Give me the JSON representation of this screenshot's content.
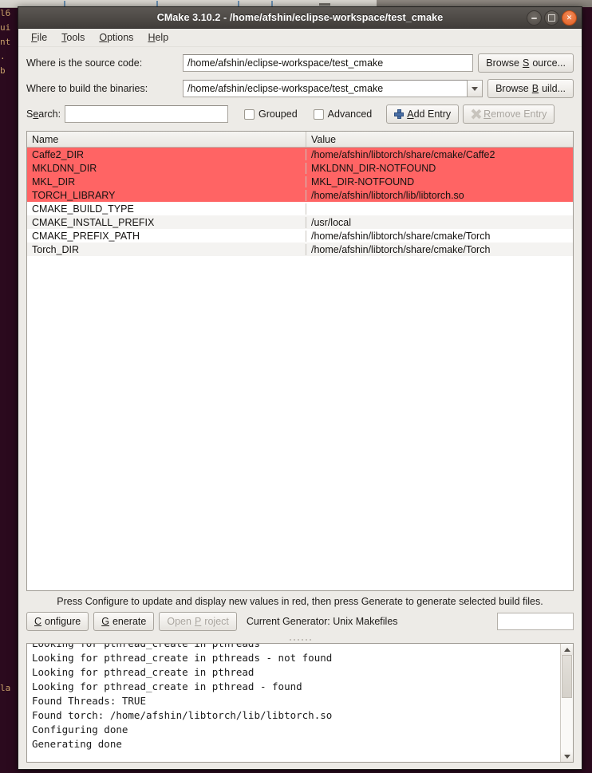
{
  "window": {
    "title": "CMake 3.10.2 - /home/afshin/eclipse-workspace/test_cmake",
    "buttons": {
      "minimize": "minimize",
      "maximize": "maximize",
      "close": "close"
    }
  },
  "menubar": [
    {
      "label": "File",
      "accel": "F"
    },
    {
      "label": "Tools",
      "accel": "T"
    },
    {
      "label": "Options",
      "accel": "O"
    },
    {
      "label": "Help",
      "accel": "H"
    }
  ],
  "form": {
    "source_label": "Where is the source code:",
    "source_value": "/home/afshin/eclipse-workspace/test_cmake",
    "browse_source_label": "Browse Source...",
    "browse_source_accel": "S",
    "build_label": "Where to build the binaries:",
    "build_value": "/home/afshin/eclipse-workspace/test_cmake",
    "browse_build_label": "Browse Build...",
    "browse_build_accel": "B"
  },
  "search": {
    "label": "Search:",
    "value": "",
    "placeholder": "",
    "grouped_label": "Grouped",
    "grouped_checked": false,
    "advanced_label": "Advanced",
    "advanced_checked": false,
    "add_entry_label": "Add Entry",
    "add_entry_accel": "A",
    "remove_entry_label": "Remove Entry",
    "remove_entry_accel": "R",
    "remove_entry_enabled": false
  },
  "table": {
    "columns": [
      "Name",
      "Value"
    ],
    "rows": [
      {
        "name": "Caffe2_DIR",
        "value": "/home/afshin/libtorch/share/cmake/Caffe2",
        "state": "new"
      },
      {
        "name": "MKLDNN_DIR",
        "value": "MKLDNN_DIR-NOTFOUND",
        "state": "new"
      },
      {
        "name": "MKL_DIR",
        "value": "MKL_DIR-NOTFOUND",
        "state": "new"
      },
      {
        "name": "TORCH_LIBRARY",
        "value": "/home/afshin/libtorch/lib/libtorch.so",
        "state": "new"
      },
      {
        "name": "CMAKE_BUILD_TYPE",
        "value": "",
        "state": "plain"
      },
      {
        "name": "CMAKE_INSTALL_PREFIX",
        "value": "/usr/local",
        "state": "alt"
      },
      {
        "name": "CMAKE_PREFIX_PATH",
        "value": "/home/afshin/libtorch/share/cmake/Torch",
        "state": "plain"
      },
      {
        "name": "Torch_DIR",
        "value": "/home/afshin/libtorch/share/cmake/Torch",
        "state": "alt"
      }
    ],
    "new_value_color": "#ff6464"
  },
  "hint": "Press Configure to update and display new values in red, then press Generate to generate selected build files.",
  "actions": {
    "configure_label": "Configure",
    "configure_accel": "C",
    "generate_label": "Generate",
    "generate_accel": "G",
    "open_project_label": "Open Project",
    "open_project_accel": "P",
    "open_project_enabled": false,
    "generator_text": "Current Generator: Unix Makefiles",
    "progress_value": ""
  },
  "output": {
    "lines": [
      "Looking for pthread_create in pthreads",
      "Looking for pthread_create in pthreads - not found",
      "Looking for pthread_create in pthread",
      "Looking for pthread_create in pthread - found",
      "Found Threads: TRUE",
      "Found torch: /home/afshin/libtorch/lib/libtorch.so",
      "Configuring done",
      "Generating done"
    ]
  },
  "background": {
    "desktop_color": "#2b0a1e",
    "terminal_snippet": "l6\nui\nnt\n.\nb\n\n\n\n\n\n\n\n\n\n\n\n\n\n\n\n\n\n\n\n\n\n\n\n\n\n\n\n\n\n\n\n\n\n\n\n\n\n\n\n\n\n\nla"
  }
}
